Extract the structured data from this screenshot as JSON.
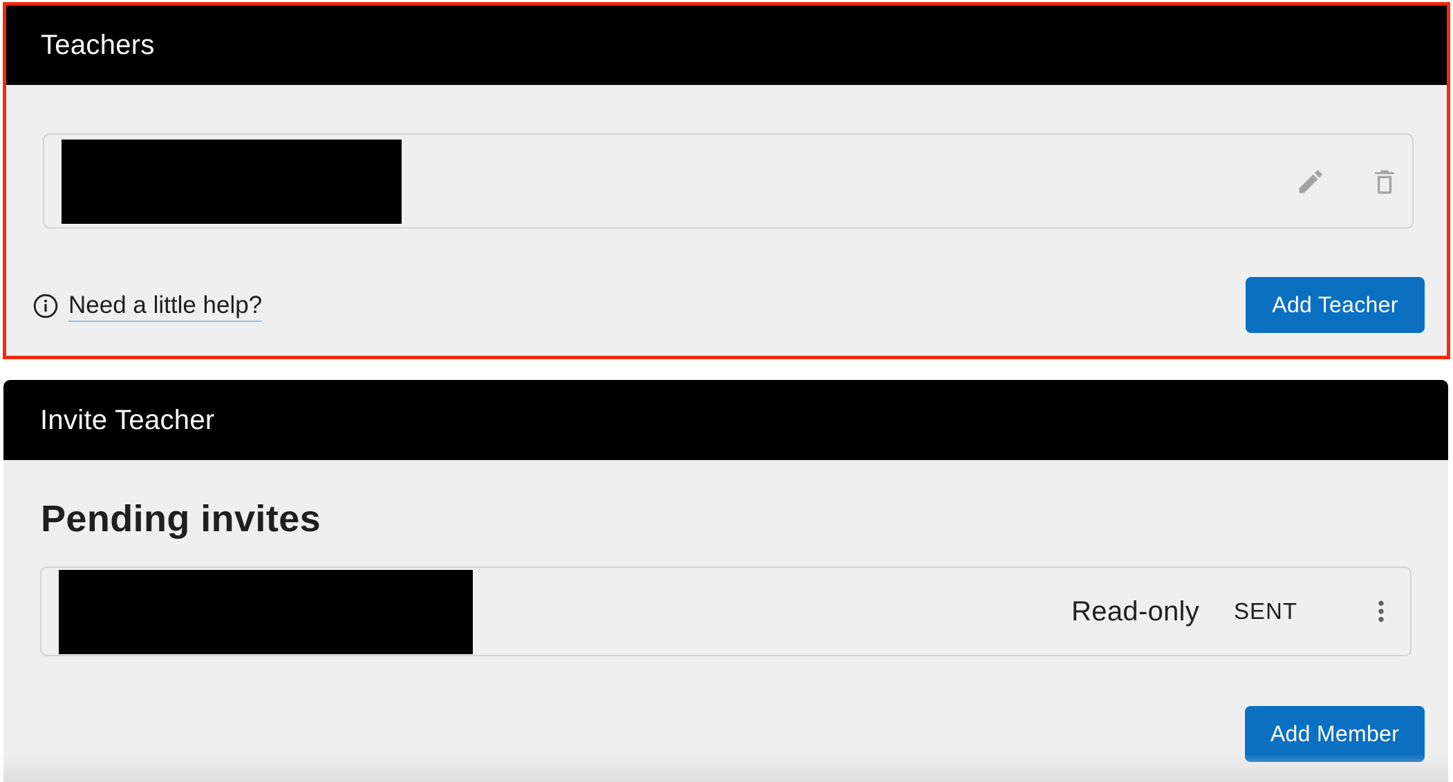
{
  "teachers_panel": {
    "title": "Teachers",
    "help_link": "Need a little help?",
    "add_button": "Add Teacher",
    "teacher_row": {
      "edit_icon": "pencil-icon",
      "delete_icon": "trash-icon"
    },
    "highlight_color": "#f22a0f"
  },
  "invite_panel": {
    "title": "Invite Teacher",
    "section_heading": "Pending invites",
    "invite_row": {
      "role": "Read-only",
      "status": "SENT",
      "menu_icon": "more-vertical-icon"
    },
    "add_button": "Add Member"
  },
  "colors": {
    "header_bg": "#000000",
    "panel_bg": "#efefef",
    "primary": "#0b6fc2"
  }
}
